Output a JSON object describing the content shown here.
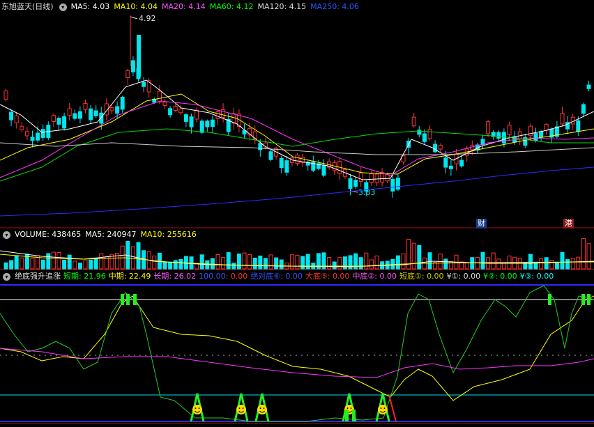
{
  "main": {
    "stock_name": "东旭蓝天(日线)",
    "ma5": "MA5: 4.03",
    "ma10": "MA10: 4.04",
    "ma20": "MA20: 4.14",
    "ma60": "MA60: 4.12",
    "ma120": "MA120: 4.15",
    "ma250": "MA250: 4.06",
    "high_label": "4.92",
    "low_label": "3.83",
    "badge_cai": "财",
    "badge_gang": "港",
    "colors": {
      "ma5": "#ffffff",
      "ma10": "#ffff00",
      "ma20": "#ff00ff",
      "ma60": "#00ff00",
      "ma120": "#cccccc",
      "ma250": "#2020ff"
    }
  },
  "volume": {
    "label": "VOLUME: 438465",
    "ma5": "MA5: 240947",
    "ma10": "MA10: 255616"
  },
  "indicator": {
    "name": "绝底强升追涨",
    "short": "短期: 21.96",
    "mid": "中期: 22.49",
    "long": "长期: 26.02",
    "v100": "100.00",
    "v0": ": 0.00",
    "abs_bottom": "绝对底⑥: 0.00",
    "big_bottom": "大底⑤: 0.00",
    "mid_bottom": "中底②: 0.00",
    "short_bottom": "短底①: 0.00",
    "y1": "¥①: 0.00",
    "y2": "¥②: 0.00",
    "y3": "¥③: 0.00"
  }
}
